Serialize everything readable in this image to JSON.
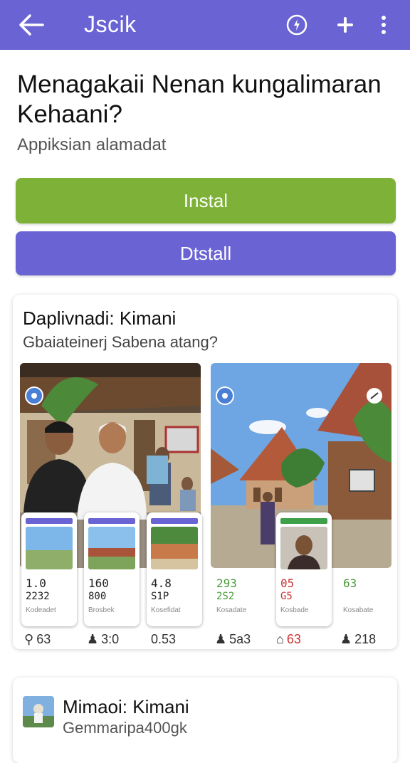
{
  "appbar": {
    "title": "Jscik",
    "color": "#6a63d4"
  },
  "heading": "Menagakaii  Nenan kungalimaran Kehaani?",
  "subtitle": "Appiksian alamadat",
  "buttons": {
    "install": "Instal",
    "detail": "Dtstall",
    "install_color": "#7eb137",
    "detail_color": "#6a63d4"
  },
  "card1": {
    "title": "Daplivnadi: Kimani",
    "subtitle": "Gbaiateinerj Sabena atang?",
    "phones": [
      {
        "line1": "1.0",
        "line2": "2232",
        "line3": "Kodeadet"
      },
      {
        "line1": "160",
        "line2": "800",
        "line3": "Brosbek"
      },
      {
        "line1": "4.8",
        "line2": "S1P",
        "line3": "Kosefidat"
      },
      {
        "line1": "293",
        "line2": "2S2",
        "line3": "Kosadate"
      },
      {
        "line1": "05",
        "line2": "G5",
        "line3": "Kosbade"
      },
      {
        "line1": "63",
        "line2": "",
        "line3": "Kosabate"
      }
    ],
    "stats": [
      {
        "icon": "pin-icon",
        "value": "63"
      },
      {
        "icon": "person-icon",
        "value": "3:0"
      },
      {
        "icon": "circle-icon",
        "value": "0.53"
      },
      {
        "icon": "person-icon",
        "value": "5a3"
      },
      {
        "icon": "home-icon",
        "value": "63"
      },
      {
        "icon": "person-icon",
        "value": "218"
      }
    ]
  },
  "card2": {
    "title": "Mimaoi: Kimani",
    "subtitle": "Gemmaripa400gk"
  }
}
